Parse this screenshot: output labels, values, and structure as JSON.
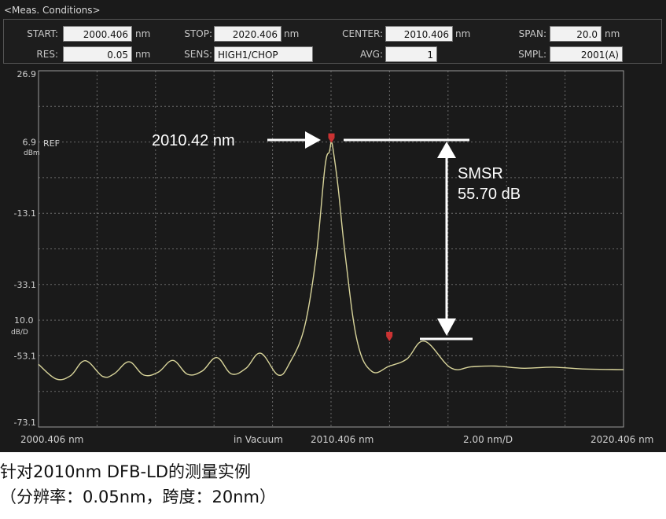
{
  "meas_conditions": {
    "title": "<Meas. Conditions>",
    "start": {
      "label": "START:",
      "value": "2000.406",
      "unit": "nm"
    },
    "stop": {
      "label": "STOP:",
      "value": "2020.406",
      "unit": "nm"
    },
    "center": {
      "label": "CENTER:",
      "value": "2010.406",
      "unit": "nm"
    },
    "span": {
      "label": "SPAN:",
      "value": "20.0",
      "unit": "nm"
    },
    "res": {
      "label": "RES:",
      "value": "0.05",
      "unit": "nm"
    },
    "sens": {
      "label": "SENS:",
      "value": "HIGH1/CHOP"
    },
    "avg": {
      "label": "AVG:",
      "value": "1"
    },
    "smpl": {
      "label": "SMPL:",
      "value": "2001(A)"
    }
  },
  "y_axis": {
    "ticks": [
      "26.9",
      "6.9",
      "-13.1",
      "-33.1",
      "-53.1",
      "-73.1"
    ],
    "ref_label": "REF",
    "ref_unit": "dBm",
    "scale_value": "10.0",
    "scale_unit": "dB/D"
  },
  "x_axis": {
    "start": "2000.406 nm",
    "medium": "in Vacuum",
    "center": "2010.406 nm",
    "per_div": "2.00 nm/D",
    "stop": "2020.406 nm"
  },
  "annotations": {
    "peak_label": "2010.42 nm",
    "smsr_title": "SMSR",
    "smsr_value": "55.70 dB"
  },
  "caption": {
    "line1": "针对2010nm DFB-LD的测量实例",
    "line2": "（分辨率：0.05nm，跨度：20nm）"
  },
  "colors": {
    "trace": "#d8d49a",
    "marker": "#cc3333",
    "grid": "#6a6a6a",
    "background": "#1a1a1a"
  },
  "chart_data": {
    "type": "line",
    "xlabel": "",
    "ylabel": "",
    "xlim": [
      2000.406,
      2020.406
    ],
    "ylim": [
      -73.1,
      26.9
    ],
    "series": [
      {
        "x": [
          2000.406,
          2001.0,
          2001.5,
          2002.0,
          2002.6,
          2003.0,
          2003.5,
          2004.0,
          2004.5,
          2005.0,
          2005.5,
          2006.0,
          2006.5,
          2007.0,
          2007.5,
          2008.0,
          2008.6,
          2009.0,
          2009.5,
          2009.9,
          2010.2,
          2010.35,
          2010.42,
          2010.5,
          2010.65,
          2010.9,
          2011.3,
          2011.8,
          2012.4,
          2013.0,
          2013.6,
          2014.5,
          2015.2,
          2016.0,
          2017.0,
          2018.0,
          2019.0,
          2020.406
        ],
        "y": [
          -55.5,
          -59.6,
          -58.7,
          -54.5,
          -58.9,
          -58.1,
          -54.8,
          -58.5,
          -57.7,
          -54.4,
          -58.3,
          -57.4,
          -53.6,
          -58.2,
          -56.6,
          -52.4,
          -58.5,
          -55.0,
          -45.0,
          -25.0,
          0.0,
          4.2,
          6.9,
          3.5,
          -6.0,
          -25.5,
          -49.0,
          -57.5,
          -56.0,
          -54.0,
          -49.0,
          -56.5,
          -56.2,
          -56.0,
          -56.6,
          -56.3,
          -56.8,
          -57.0
        ]
      }
    ],
    "markers": [
      {
        "x": 2010.42,
        "y": 6.9
      },
      {
        "x": 2012.4,
        "y": -48.8
      }
    ]
  }
}
